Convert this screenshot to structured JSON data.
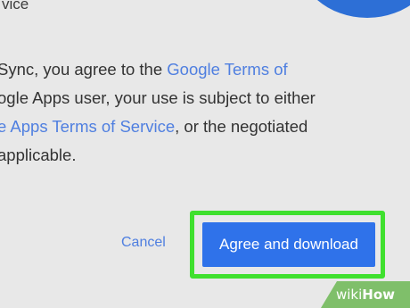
{
  "header": {
    "partial_text": "vice"
  },
  "terms": {
    "line1_prefix": "Sync, you agree to the ",
    "line1_link": "Google Terms of",
    "line2": "ogle Apps user, your use is subject to either",
    "line3_link": "e Apps Terms of Service",
    "line3_suffix": ", or the negotiated",
    "line4": "applicable."
  },
  "actions": {
    "cancel_label": "Cancel",
    "agree_label": "Agree and download"
  },
  "watermark": {
    "wiki": "wiki",
    "how": "How"
  },
  "colors": {
    "link": "#4f7fe0",
    "primary_button": "#2f72ea",
    "highlight_border": "#3fe02e",
    "brand_circle": "#2d6fd6",
    "background": "#e8e8e8"
  }
}
